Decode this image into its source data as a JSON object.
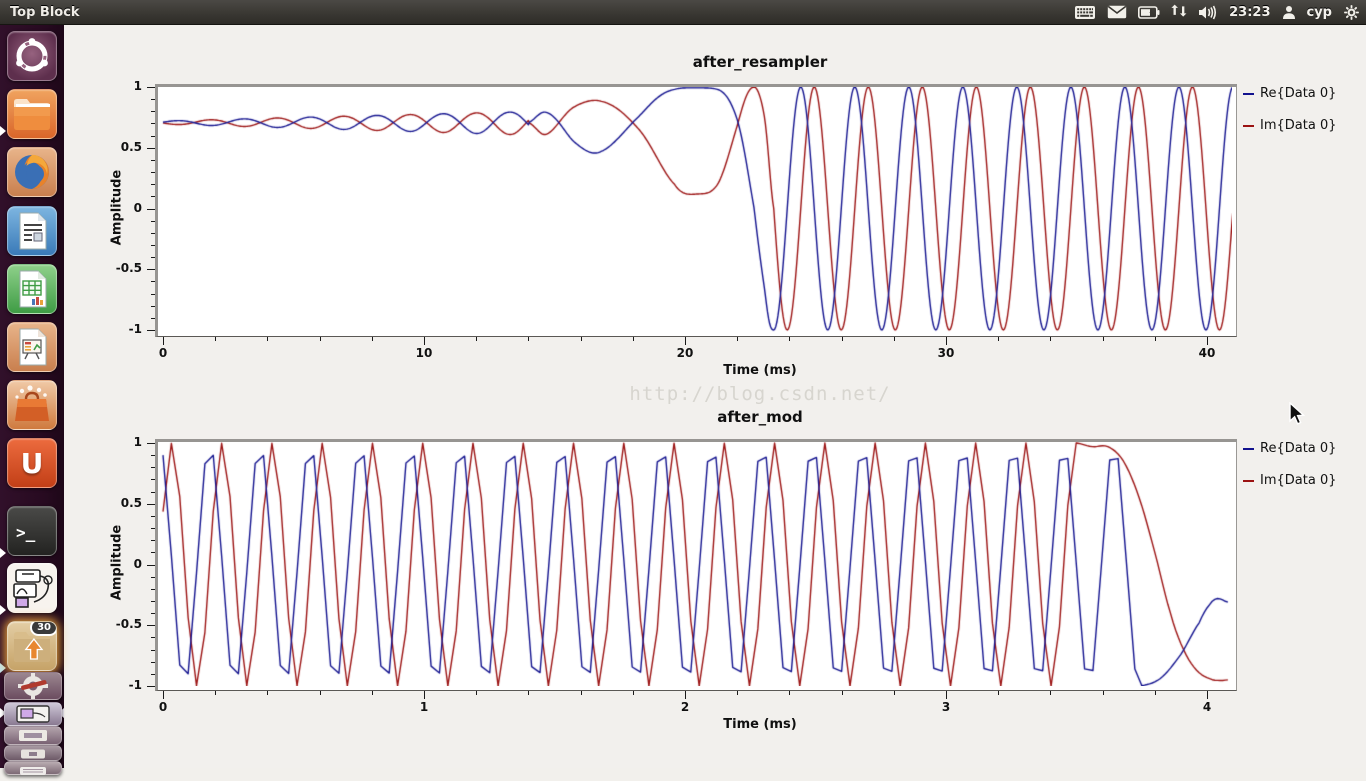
{
  "top_bar": {
    "title": "Top Block",
    "clock": "23:23",
    "user": "cyp",
    "indicator_icons": [
      "keyboard-indicator",
      "messaging-indicator",
      "battery-indicator",
      "sync-arrows-indicator",
      "sound-indicator",
      "user-indicator",
      "session-gear-indicator"
    ]
  },
  "launcher": {
    "items": [
      {
        "name": "dash-home"
      },
      {
        "name": "files",
        "active": true
      },
      {
        "name": "firefox"
      },
      {
        "name": "libreoffice-writer"
      },
      {
        "name": "libreoffice-calc"
      },
      {
        "name": "libreoffice-impress"
      },
      {
        "name": "software-center"
      },
      {
        "name": "ubuntu-one",
        "glyph": "U"
      },
      {
        "name": "terminal",
        "glyph": ">_",
        "active": true
      },
      {
        "name": "gnuradio-companion",
        "active": true
      },
      {
        "name": "update-folder",
        "badge": "30",
        "active": true
      },
      {
        "name": "folded-app-stack"
      }
    ]
  },
  "window": {
    "watermark": "http://blog.csdn.net/"
  },
  "chart_data": [
    {
      "type": "line",
      "title": "after_resampler",
      "xlabel": "Time (ms)",
      "ylabel": "Amplitude",
      "xlim": [
        0,
        41.1
      ],
      "ylim": [
        -1,
        1
      ],
      "grid": false,
      "legend_position": "right-outside",
      "xticks": [
        {
          "v": 0,
          "label": "0"
        },
        {
          "v": 10,
          "label": "10"
        },
        {
          "v": 20,
          "label": "20"
        },
        {
          "v": 30,
          "label": "30"
        },
        {
          "v": 40,
          "label": "40"
        }
      ],
      "yticks": [
        {
          "v": 1,
          "label": "1"
        },
        {
          "v": 0.5,
          "label": "0.5"
        },
        {
          "v": 0,
          "label": "0"
        },
        {
          "v": -0.5,
          "label": "-0.5"
        },
        {
          "v": -1,
          "label": "-1"
        }
      ],
      "xminor_step": 2,
      "yminor_step": 0.1,
      "series": [
        {
          "name": "Re{Data 0}",
          "color": "#12128e",
          "role": "re"
        },
        {
          "name": "Im{Data 0}",
          "color": "#9b1212",
          "role": "im"
        }
      ],
      "signal_model": {
        "kind": "phase_fm",
        "description": "unit-amplitude complex tone: Re=cos(phi(t)), Im=sin(phi(t)); flat ~0.707 with growing braiding, slow swing 14-23.4ms, then steady rotation",
        "dt": 0.04,
        "wiggle": {
          "base_phase": 0.7854,
          "amp0": 0.018,
          "amp_slope": 0.0085,
          "period_ms": 2.55,
          "phase_offset": 0.25,
          "t_end": 14
        },
        "phase_keys": [
          [
            14,
            0.785
          ],
          [
            14.7,
            0.66
          ],
          [
            15.8,
            1.0
          ],
          [
            16.8,
            1.08
          ],
          [
            18.2,
            0.72
          ],
          [
            19.6,
            0.2
          ],
          [
            20.5,
            0.12
          ],
          [
            21.3,
            0.22
          ],
          [
            22.0,
            0.75
          ],
          [
            22.65,
            1.5708
          ],
          [
            23.05,
            2.3
          ],
          [
            23.4,
            3.1416
          ]
        ],
        "steady": {
          "t0": 23.4,
          "phi0": 3.1416,
          "period_ms": 2.07
        }
      }
    },
    {
      "type": "line",
      "title": "after_mod",
      "xlabel": "Time (ms)",
      "ylabel": "Amplitude",
      "xlim": [
        0,
        4.08
      ],
      "ylim": [
        -1,
        1
      ],
      "grid": false,
      "legend_position": "right-outside",
      "xticks": [
        {
          "v": 0,
          "label": "0"
        },
        {
          "v": 1,
          "label": "1"
        },
        {
          "v": 2,
          "label": "2"
        },
        {
          "v": 3,
          "label": "3"
        },
        {
          "v": 4,
          "label": "4"
        }
      ],
      "yticks": [
        {
          "v": 1,
          "label": "1"
        },
        {
          "v": 0.5,
          "label": "0.5"
        },
        {
          "v": 0,
          "label": "0"
        },
        {
          "v": -0.5,
          "label": "-0.5"
        },
        {
          "v": -1,
          "label": "-1"
        }
      ],
      "xminor_step": 0.2,
      "yminor_step": 0.1,
      "series": [
        {
          "name": "Re{Data 0}",
          "color": "#12128e",
          "role": "re"
        },
        {
          "name": "Im{Data 0}",
          "color": "#9b1212",
          "role": "im"
        }
      ],
      "signal_model": {
        "kind": "iq_burst",
        "description": "coarsely-sampled +-1 quadrature tone (jagged), rotation stops near 3.5-3.7ms leaving smooth settling tails",
        "dt": 0.0321,
        "theta0": 0.45,
        "period_ms": 0.1925,
        "re_jagged_end": 3.74,
        "im_jagged_end": 3.5,
        "re_tail": [
          [
            3.74,
            -1.0
          ],
          [
            3.82,
            -0.94
          ],
          [
            3.9,
            -0.74
          ],
          [
            3.97,
            -0.48
          ],
          [
            4.01,
            -0.33
          ],
          [
            4.04,
            -0.28
          ],
          [
            4.08,
            -0.31
          ]
        ],
        "im_tail": [
          [
            3.5,
            1.0
          ],
          [
            3.56,
            0.97
          ],
          [
            3.62,
            0.97
          ],
          [
            3.68,
            0.85
          ],
          [
            3.74,
            0.55
          ],
          [
            3.8,
            0.1
          ],
          [
            3.86,
            -0.4
          ],
          [
            3.91,
            -0.7
          ],
          [
            3.96,
            -0.87
          ],
          [
            4.01,
            -0.94
          ],
          [
            4.05,
            -0.955
          ],
          [
            4.08,
            -0.95
          ]
        ]
      }
    }
  ]
}
